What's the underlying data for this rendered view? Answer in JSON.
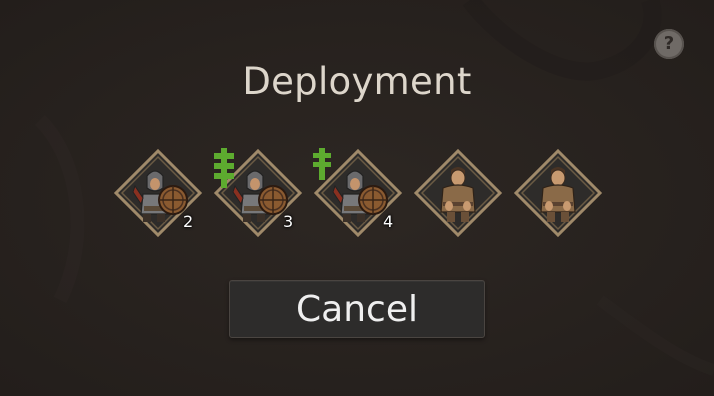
{
  "dialog": {
    "title": "Deployment",
    "help_label": "?",
    "cancel_label": "Cancel"
  },
  "units": [
    {
      "type": "shield-soldier",
      "count": "2",
      "upgraded": false
    },
    {
      "type": "shield-soldier",
      "count": "3",
      "upgraded": true
    },
    {
      "type": "shield-soldier",
      "count": "4",
      "upgraded": true
    },
    {
      "type": "peasant",
      "count": "",
      "upgraded": false
    },
    {
      "type": "peasant",
      "count": "",
      "upgraded": false
    }
  ],
  "colors": {
    "background": "#2a2420",
    "frame_gold": "#a08a6a",
    "card_fill": "#2e2c2a",
    "upgrade_green": "#5dab2f",
    "title_text": "#ddd6cb"
  }
}
